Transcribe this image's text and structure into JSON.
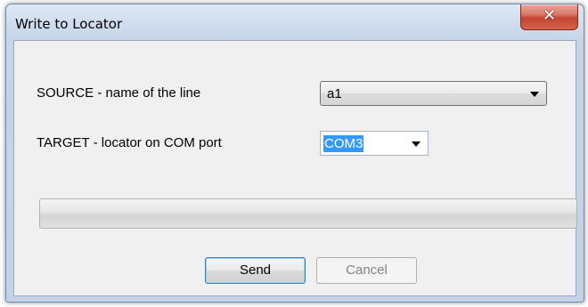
{
  "window": {
    "title": "Write to Locator",
    "close_glyph": "✕",
    "close_icon": "close-icon"
  },
  "source": {
    "label": "SOURCE - name of the line",
    "value": "a1"
  },
  "target": {
    "label": "TARGET - locator on COM port",
    "value": "COM3"
  },
  "progress": {
    "fraction": 0
  },
  "buttons": {
    "send_label": "Send",
    "cancel_label": "Cancel"
  },
  "colors": {
    "selection": "#3399ff",
    "close_button": "#c34530"
  }
}
